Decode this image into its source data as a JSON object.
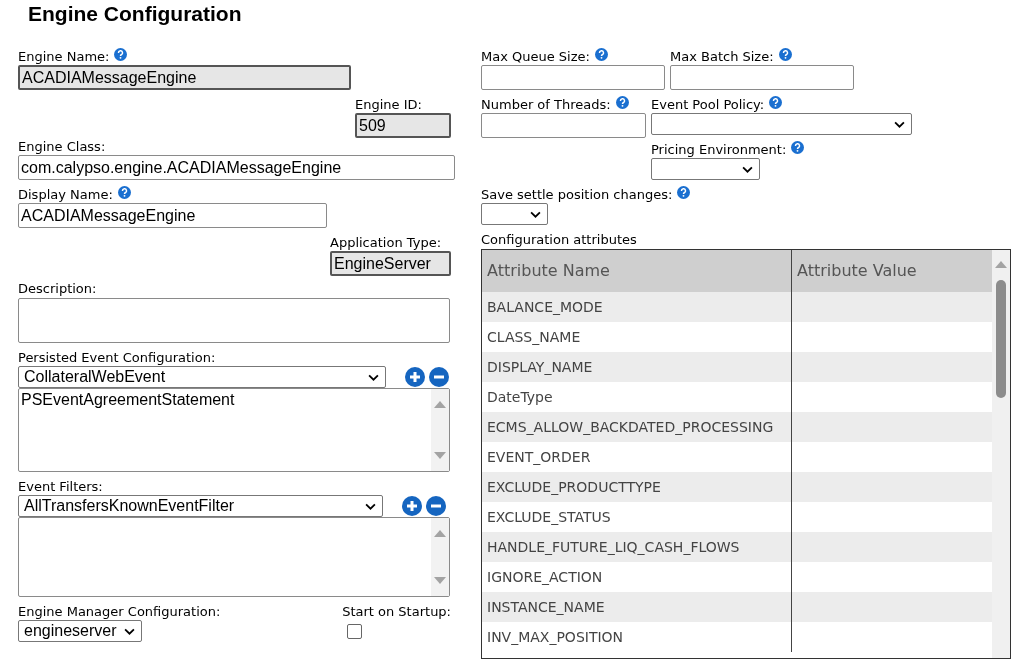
{
  "title": "Engine Configuration",
  "engine_name": {
    "label": "Engine Name:",
    "help": true,
    "value": "ACADIAMessageEngine",
    "disabled": true
  },
  "engine_id": {
    "label": "Engine ID:",
    "help": false,
    "value": "509",
    "disabled": true
  },
  "engine_class": {
    "label": "Engine Class:",
    "help": false,
    "value": "com.calypso.engine.ACADIAMessageEngine",
    "disabled": false
  },
  "display_name": {
    "label": "Display Name:",
    "help": true,
    "value": "ACADIAMessageEngine",
    "disabled": false
  },
  "application_type": {
    "label": "Application Type:",
    "help": false,
    "value": "EngineServer",
    "disabled": true
  },
  "description": {
    "label": "Description:"
  },
  "persisted_events": {
    "label": "Persisted Event Configuration:",
    "selected_value": "CollateralWebEvent",
    "items": [
      "PSEventAgreementStatement"
    ]
  },
  "event_filters": {
    "label": "Event Filters:",
    "selected_value": "AllTransfersKnownEventFilter"
  },
  "engine_manager": {
    "label": "Engine Manager Configuration:",
    "value": "engineserver"
  },
  "start_on_startup": {
    "label": "Start on Startup:",
    "checked": false
  },
  "max_queue_size": {
    "label": "Max Queue Size:",
    "help": true
  },
  "max_batch_size": {
    "label": "Max Batch Size:",
    "help": true
  },
  "number_of_threads": {
    "label": "Number of Threads:",
    "help": true
  },
  "event_pool_policy": {
    "label": "Event Pool Policy:",
    "help": true
  },
  "pricing_environment": {
    "label": "Pricing Environment:",
    "help": true
  },
  "save_settle": {
    "label": "Save settle position changes:",
    "help": true
  },
  "attributes": {
    "label": "Configuration attributes",
    "columns": [
      "Attribute Name",
      "Attribute Value"
    ],
    "rows": [
      "BALANCE_MODE",
      "CLASS_NAME",
      "DISPLAY_NAME",
      "DateType",
      "ECMS_ALLOW_BACKDATED_PROCESSING",
      "EVENT_ORDER",
      "EXCLUDE_PRODUCTTYPE",
      "EXCLUDE_STATUS",
      "HANDLE_FUTURE_LIQ_CASH_FLOWS",
      "IGNORE_ACTION",
      "INSTANCE_NAME",
      "INV_MAX_POSITION"
    ]
  }
}
